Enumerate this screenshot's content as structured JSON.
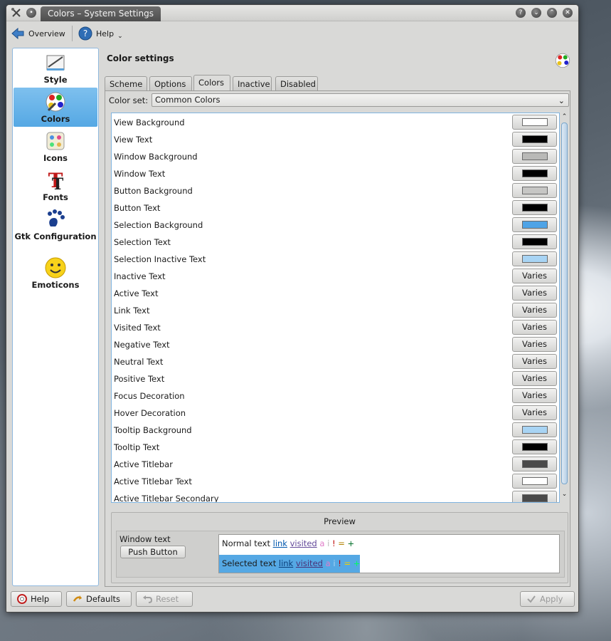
{
  "window": {
    "title": "Colors – System Settings"
  },
  "toolbar": {
    "overview_label": "Overview",
    "help_label": "Help"
  },
  "sidebar": {
    "items": [
      {
        "label": "Style"
      },
      {
        "label": "Colors"
      },
      {
        "label": "Icons"
      },
      {
        "label": "Fonts"
      },
      {
        "label": "Gtk Configuration"
      },
      {
        "label": "Emoticons"
      }
    ]
  },
  "header": {
    "title": "Color settings"
  },
  "tabs": [
    {
      "label": "Scheme"
    },
    {
      "label": "Options"
    },
    {
      "label": "Colors"
    },
    {
      "label": "Inactive"
    },
    {
      "label": "Disabled"
    }
  ],
  "colorset": {
    "label": "Color set:",
    "value": "Common Colors"
  },
  "roles": [
    {
      "label": "View Background",
      "kind": "swatch",
      "color": "#ffffff"
    },
    {
      "label": "View Text",
      "kind": "swatch",
      "color": "#000000"
    },
    {
      "label": "Window Background",
      "kind": "swatch",
      "color": "#b9b9b7"
    },
    {
      "label": "Window Text",
      "kind": "swatch",
      "color": "#000000"
    },
    {
      "label": "Button Background",
      "kind": "swatch",
      "color": "#c6c6c4"
    },
    {
      "label": "Button Text",
      "kind": "swatch",
      "color": "#000000"
    },
    {
      "label": "Selection Background",
      "kind": "swatch",
      "color": "#4ea3e6"
    },
    {
      "label": "Selection Text",
      "kind": "swatch",
      "color": "#000000"
    },
    {
      "label": "Selection Inactive Text",
      "kind": "swatch",
      "color": "#a8d4f4"
    },
    {
      "label": "Inactive Text",
      "kind": "varies",
      "value": "Varies"
    },
    {
      "label": "Active Text",
      "kind": "varies",
      "value": "Varies"
    },
    {
      "label": "Link Text",
      "kind": "varies",
      "value": "Varies"
    },
    {
      "label": "Visited Text",
      "kind": "varies",
      "value": "Varies"
    },
    {
      "label": "Negative Text",
      "kind": "varies",
      "value": "Varies"
    },
    {
      "label": "Neutral Text",
      "kind": "varies",
      "value": "Varies"
    },
    {
      "label": "Positive Text",
      "kind": "varies",
      "value": "Varies"
    },
    {
      "label": "Focus Decoration",
      "kind": "varies",
      "value": "Varies"
    },
    {
      "label": "Hover Decoration",
      "kind": "varies",
      "value": "Varies"
    },
    {
      "label": "Tooltip Background",
      "kind": "swatch",
      "color": "#a8d4f4"
    },
    {
      "label": "Tooltip Text",
      "kind": "swatch",
      "color": "#000000"
    },
    {
      "label": "Active Titlebar",
      "kind": "swatch",
      "color": "#4a4a4a"
    },
    {
      "label": "Active Titlebar Text",
      "kind": "swatch",
      "color": "#ffffff"
    },
    {
      "label": "Active Titlebar Secondary",
      "kind": "swatch",
      "color": "#4a4a4a"
    }
  ],
  "preview": {
    "title": "Preview",
    "window_text": "Window text",
    "push_button": "Push Button",
    "normal_text": "Normal text",
    "selected_text": "Selected text",
    "link": "link",
    "visited": "visited",
    "a": "a",
    "i": "i",
    "bang": "!",
    "eq": "=",
    "plus": "+"
  },
  "buttons": {
    "help": "Help",
    "defaults": "Defaults",
    "reset": "Reset",
    "apply": "Apply"
  },
  "colors": {
    "accent": "#55a8e4",
    "link": "#0057ae",
    "visited": "#644a9b",
    "inactive": "#e07cc8",
    "negative": "#bf0303",
    "neutral": "#b08000",
    "positive": "#006e28"
  }
}
